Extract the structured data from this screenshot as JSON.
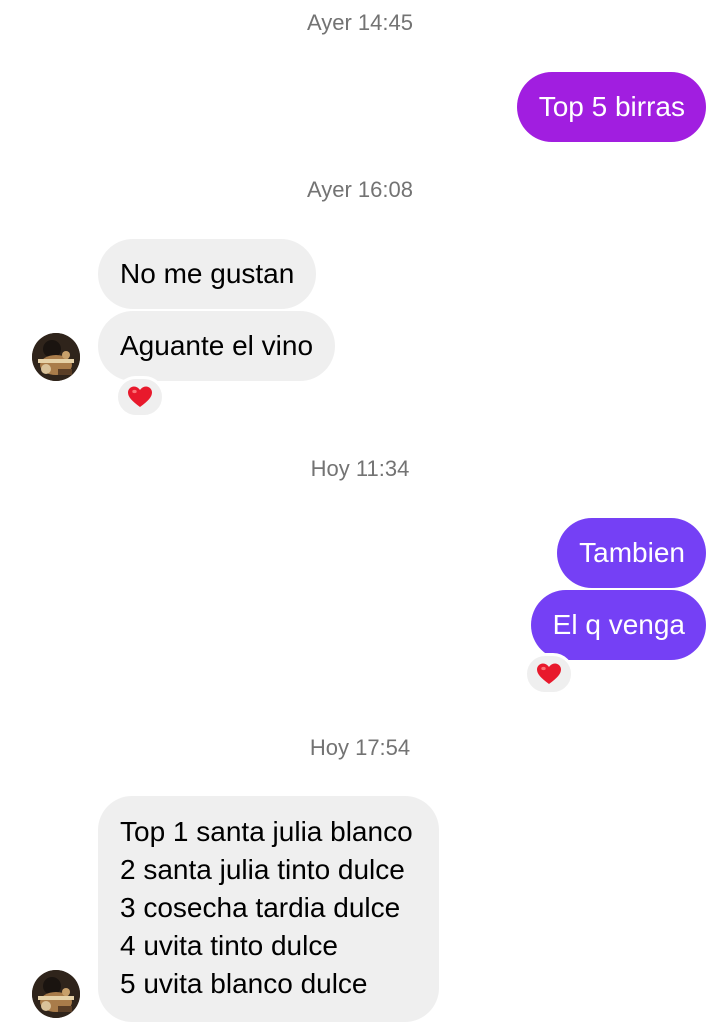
{
  "thread": {
    "timestamps": [
      "Ayer 14:45",
      "Ayer 16:08",
      "Hoy 11:34",
      "Hoy 17:54"
    ],
    "messages": {
      "m1": "Top 5 birras",
      "m2": "No me gustan",
      "m3": "Aguante el vino",
      "m4": "Tambien",
      "m5": "El q venga",
      "m6": [
        "Top 1 santa julia blanco",
        "2 santa julia tinto dulce",
        "3 cosecha tardia dulce",
        "4 uvita tinto dulce",
        "5 uvita blanco dulce"
      ]
    },
    "reactions": {
      "r1": "❤",
      "r2": "❤"
    }
  },
  "colors": {
    "outgoing_magenta": "#a11ee0",
    "outgoing_violet": "#7540f5",
    "incoming_bg": "#efefef",
    "heart": "#e8192c",
    "timestamp": "#737373"
  },
  "icons": [
    "heart-icon",
    "avatar"
  ]
}
